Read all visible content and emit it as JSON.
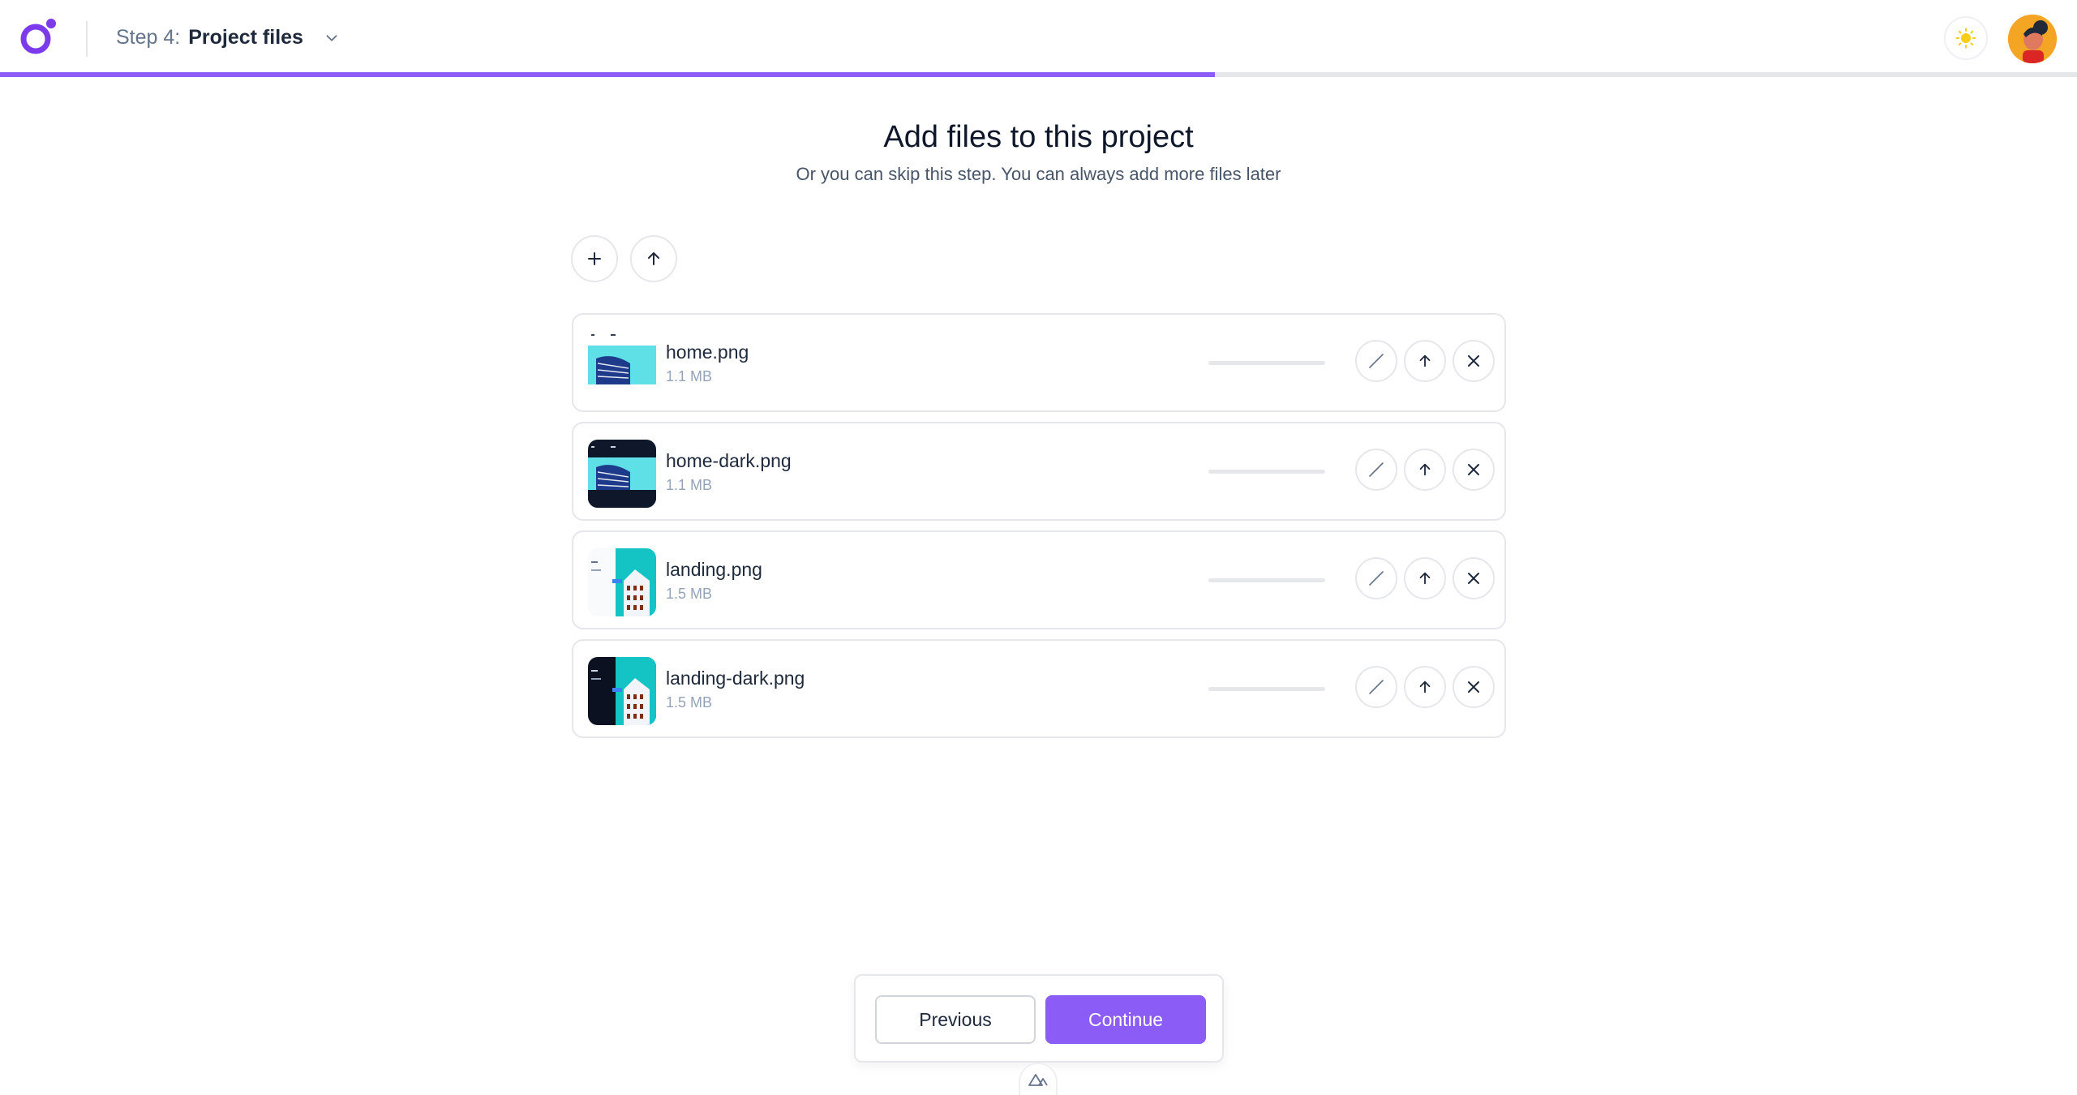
{
  "header": {
    "step_prefix": "Step 4:",
    "step_title": "Project files",
    "progress_fraction": 0.585,
    "accent_color": "#8b5cf6"
  },
  "main": {
    "title": "Add files to this project",
    "subtitle": "Or you can skip this step. You can always add more files later",
    "toolbar": {
      "add_icon": "plus-icon",
      "upload_icon": "arrow-up-icon"
    },
    "files": [
      {
        "name": "home.png",
        "size": "1.1 MB",
        "progress": 0
      },
      {
        "name": "home-dark.png",
        "size": "1.1 MB",
        "progress": 0
      },
      {
        "name": "landing.png",
        "size": "1.5 MB",
        "progress": 0
      },
      {
        "name": "landing-dark.png",
        "size": "1.5 MB",
        "progress": 0
      }
    ]
  },
  "footer": {
    "previous_label": "Previous",
    "continue_label": "Continue"
  }
}
